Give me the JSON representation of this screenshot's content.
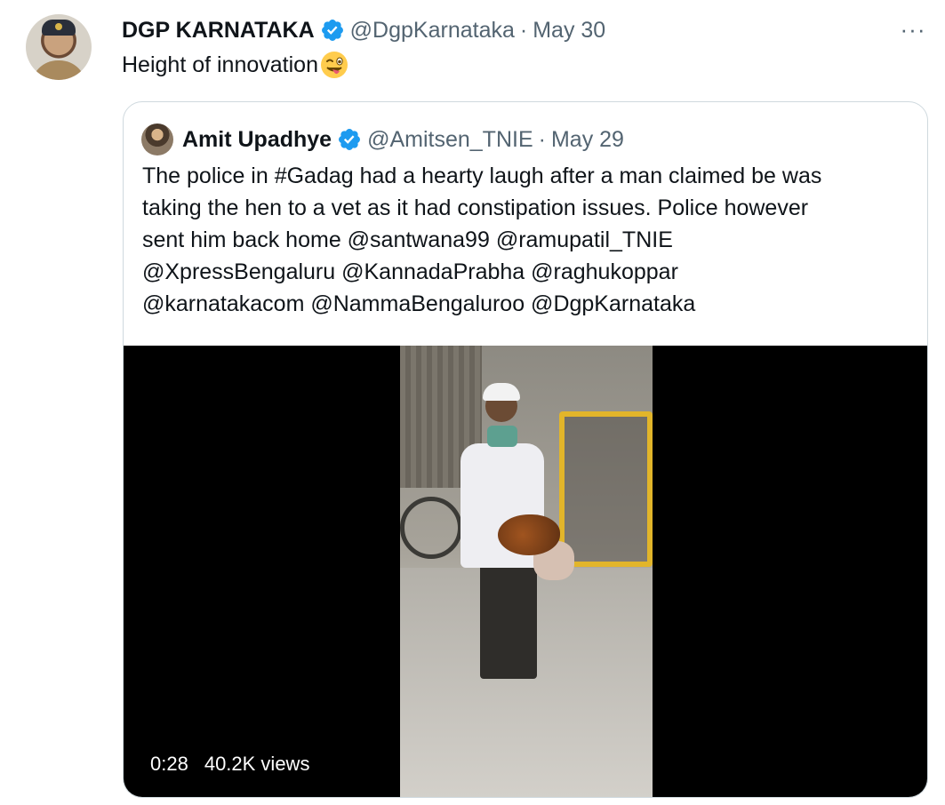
{
  "tweet": {
    "author_name": "DGP KARNATAKA",
    "author_handle": "@DgpKarnataka",
    "separator": "·",
    "date": "May 30",
    "text": "Height of innovation",
    "emoji": "winking-face-with-tongue",
    "more_label": "···"
  },
  "quoted_tweet": {
    "author_name": "Amit Upadhye",
    "author_handle": "@Amitsen_TNIE",
    "separator": "·",
    "date": "May 29",
    "text_lines": [
      "The police in #Gadag had a hearty laugh after a man claimed be was",
      "taking the hen to a vet as it had constipation issues. Police however",
      "sent him back home @santwana99 @ramupatil_TNIE",
      "@XpressBengaluru @KannadaPrabha @raghukoppar",
      "@karnatakacom @NammaBengaluroo @DgpKarnataka"
    ],
    "video": {
      "duration": "0:28",
      "views": "40.2K views"
    }
  },
  "colors": {
    "verified": "#1d9bf0",
    "secondary_text": "#536471",
    "border": "#cfd9de"
  }
}
